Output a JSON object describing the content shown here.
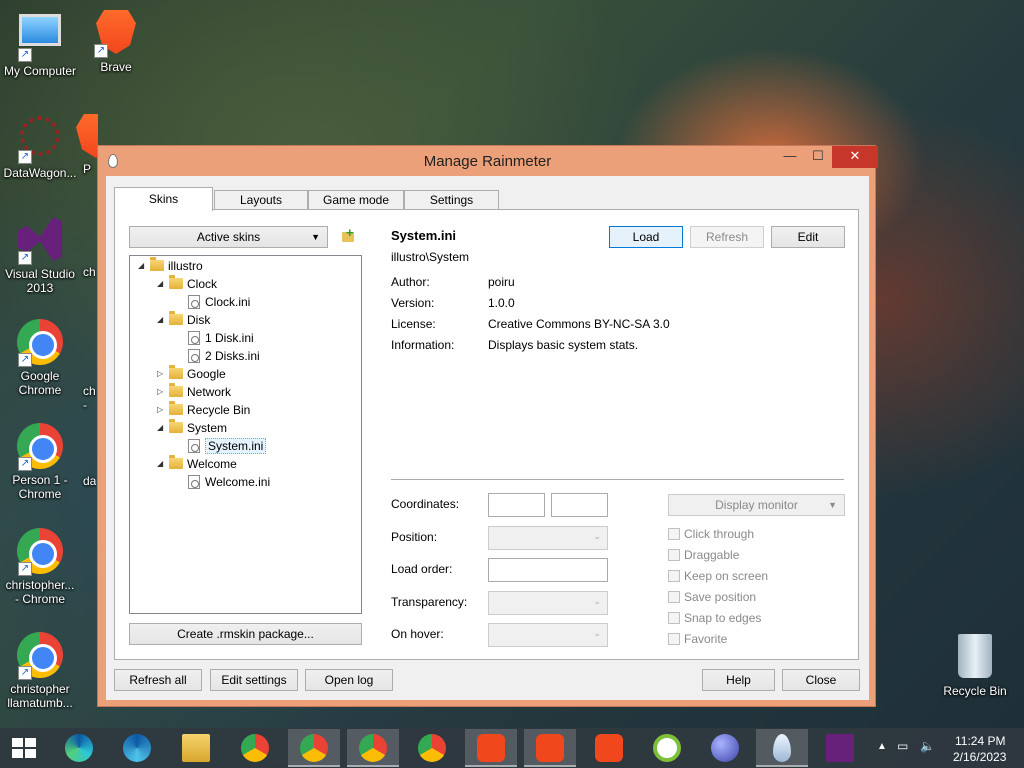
{
  "desktop": {
    "icons": [
      {
        "label": "My Computer",
        "icon": "computer-icon"
      },
      {
        "label": "Brave",
        "icon": "brave-icon"
      },
      {
        "label": "DataWagon...",
        "icon": "datawagon-icon"
      },
      {
        "label": "P",
        "icon": "brave-profile-icon"
      },
      {
        "label": "Visual Studio\n2013",
        "icon": "visual-studio-icon"
      },
      {
        "label": "ch",
        "icon": "partial-icon"
      },
      {
        "label": "Google\nChrome",
        "icon": "chrome-icon"
      },
      {
        "label": "ch\n-",
        "icon": "partial-icon"
      },
      {
        "label": "Person 1 -\nChrome",
        "icon": "chrome-icon"
      },
      {
        "label": "da",
        "icon": "partial-icon"
      },
      {
        "label": "christopher...\n- Chrome",
        "icon": "chrome-icon"
      },
      {
        "label": "christopher\nllamatumb...",
        "icon": "chrome-icon"
      },
      {
        "label": "Recycle Bin",
        "icon": "recycle-bin-icon"
      }
    ]
  },
  "window": {
    "title": "Manage Rainmeter",
    "controls": {
      "minimize": "—",
      "maximize": "☐",
      "close": "✕"
    },
    "tabs": [
      {
        "label": "Skins",
        "active": true
      },
      {
        "label": "Layouts",
        "active": false
      },
      {
        "label": "Game mode",
        "active": false
      },
      {
        "label": "Settings",
        "active": false
      }
    ],
    "skins_panel": {
      "active_skins_dropdown": "Active skins",
      "tree": [
        {
          "label": "illustro",
          "type": "folder",
          "level": 0,
          "expanded": true
        },
        {
          "label": "Clock",
          "type": "folder",
          "level": 1,
          "expanded": true
        },
        {
          "label": "Clock.ini",
          "type": "file",
          "level": 2
        },
        {
          "label": "Disk",
          "type": "folder",
          "level": 1,
          "expanded": true
        },
        {
          "label": "1 Disk.ini",
          "type": "file",
          "level": 2
        },
        {
          "label": "2 Disks.ini",
          "type": "file",
          "level": 2
        },
        {
          "label": "Google",
          "type": "folder",
          "level": 1,
          "expanded": false
        },
        {
          "label": "Network",
          "type": "folder",
          "level": 1,
          "expanded": false
        },
        {
          "label": "Recycle Bin",
          "type": "folder",
          "level": 1,
          "expanded": false
        },
        {
          "label": "System",
          "type": "folder",
          "level": 1,
          "expanded": true
        },
        {
          "label": "System.ini",
          "type": "file",
          "level": 2,
          "selected": true
        },
        {
          "label": "Welcome",
          "type": "folder",
          "level": 1,
          "expanded": true
        },
        {
          "label": "Welcome.ini",
          "type": "file",
          "level": 2
        }
      ],
      "create_package_button": "Create .rmskin package..."
    },
    "details": {
      "skin_name": "System.ini",
      "skin_path": "illustro\\System",
      "buttons": {
        "load": "Load",
        "refresh": "Refresh",
        "edit": "Edit"
      },
      "metadata": [
        {
          "label": "Author:",
          "value": "poiru"
        },
        {
          "label": "Version:",
          "value": "1.0.0"
        },
        {
          "label": "License:",
          "value": "Creative Commons BY-NC-SA 3.0"
        },
        {
          "label": "Information:",
          "value": "Displays basic system stats."
        }
      ],
      "settings_labels": {
        "coordinates": "Coordinates:",
        "position": "Position:",
        "load_order": "Load order:",
        "transparency": "Transparency:",
        "on_hover": "On hover:"
      },
      "display_monitor": "Display monitor",
      "checkboxes": [
        "Click through",
        "Draggable",
        "Keep on screen",
        "Save position",
        "Snap to edges",
        "Favorite"
      ]
    },
    "footer": {
      "refresh_all": "Refresh all",
      "edit_settings": "Edit settings",
      "open_log": "Open log",
      "help": "Help",
      "close": "Close"
    }
  },
  "taskbar": {
    "items": [
      "windows-start",
      "edge",
      "edge-beta",
      "file-explorer",
      "chrome",
      "chrome-profile-1",
      "chrome-profile-2",
      "chrome-profile-3",
      "brave-1",
      "brave-2",
      "brave-3",
      "greenshot",
      "marble",
      "rainmeter",
      "visual-studio"
    ],
    "time": "11:24 PM",
    "date": "2/16/2023"
  }
}
